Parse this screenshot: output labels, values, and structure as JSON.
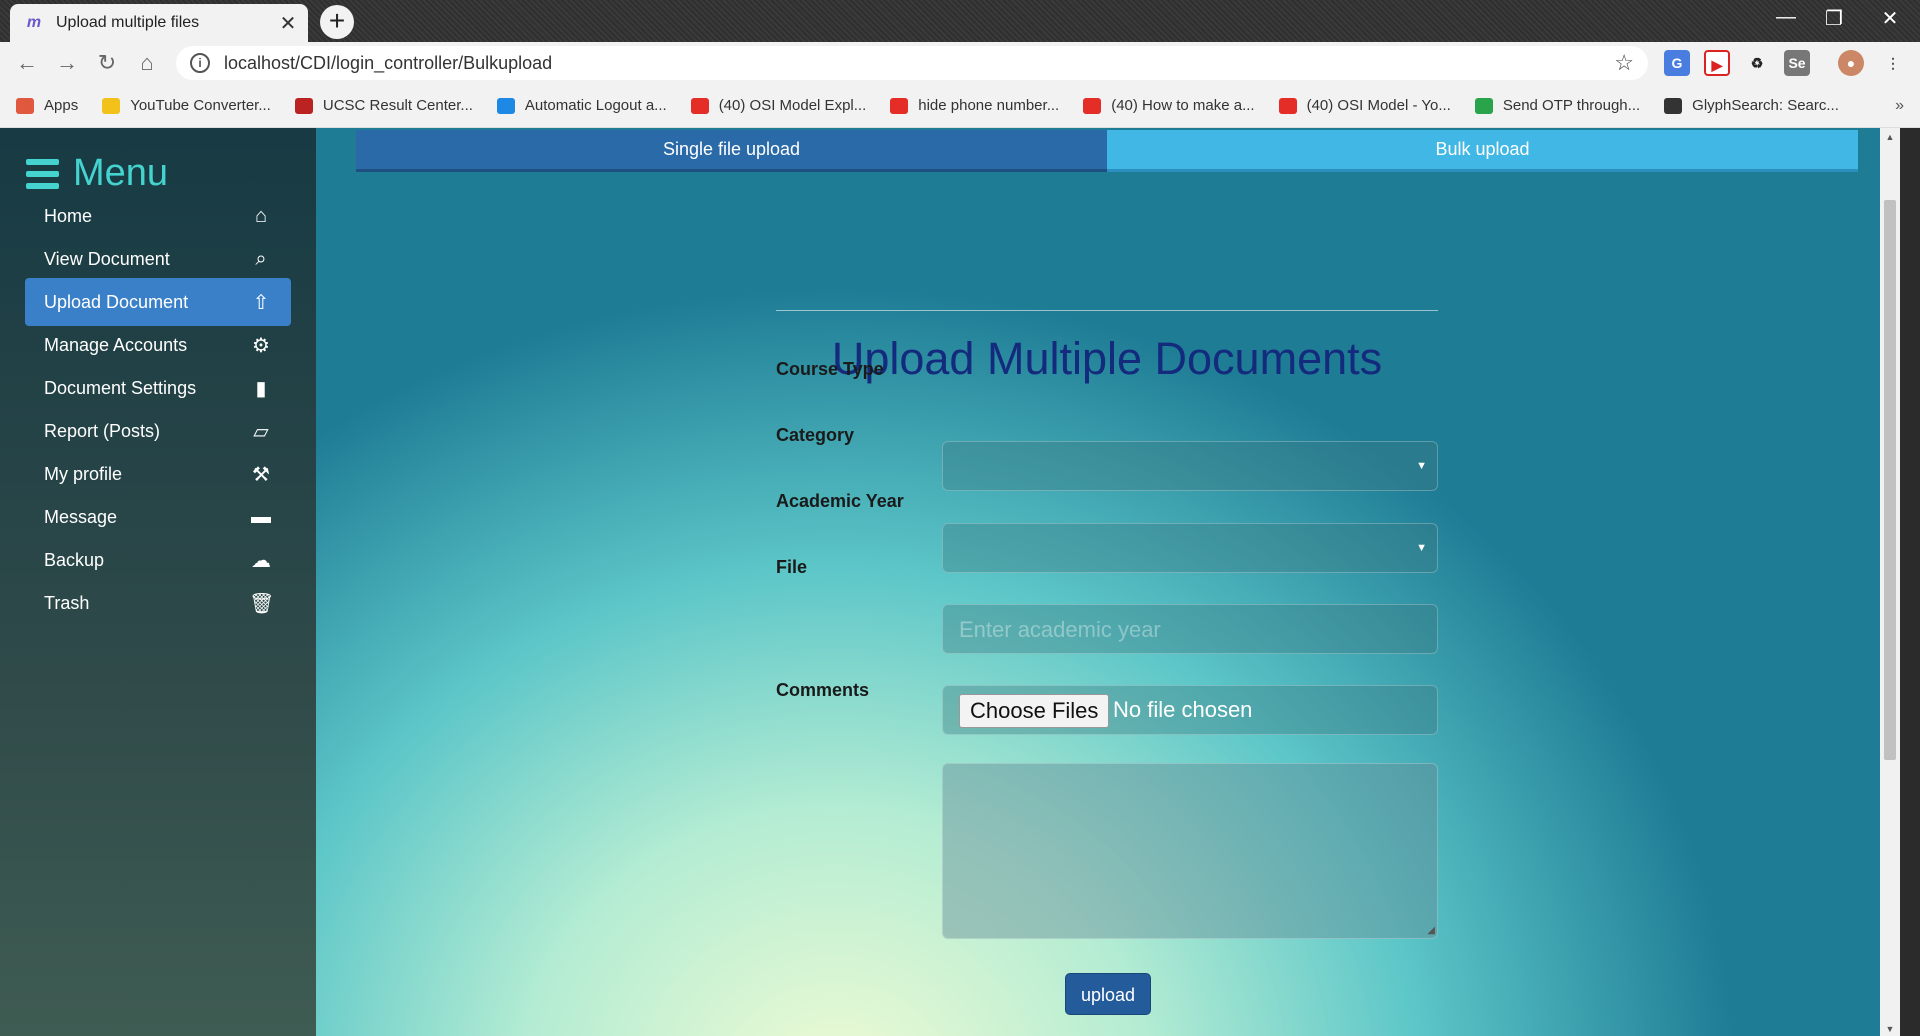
{
  "browser": {
    "tab_title": "Upload multiple files",
    "tab_close": "✕",
    "new_tab": "+",
    "window_controls": {
      "minimize": "—",
      "maximize": "❐",
      "close": "✕"
    },
    "url": "localhost/CDI/login_controller/Bulkupload",
    "bookmarks": [
      {
        "label": "Apps",
        "icon": "apps-icon",
        "color": "#e0583d"
      },
      {
        "label": "YouTube Converter...",
        "icon": "smiley-icon",
        "color": "#f2c21b"
      },
      {
        "label": "UCSC Result Center...",
        "icon": "page-icon",
        "color": "#b22"
      },
      {
        "label": "Automatic Logout a...",
        "icon": "w-icon",
        "color": "#1e88e5"
      },
      {
        "label": "(40) OSI Model Expl...",
        "icon": "youtube-icon",
        "color": "#e52d27"
      },
      {
        "label": "hide phone number...",
        "icon": "youtube-icon",
        "color": "#e52d27"
      },
      {
        "label": "(40) How to make a...",
        "icon": "youtube-icon",
        "color": "#e52d27"
      },
      {
        "label": "(40) OSI Model - Yo...",
        "icon": "youtube-icon",
        "color": "#e52d27"
      },
      {
        "label": "Send OTP through...",
        "icon": "s-icon",
        "color": "#2aa44a"
      },
      {
        "label": "GlyphSearch: Searc...",
        "icon": "glyph-icon",
        "color": "#333"
      }
    ],
    "more_bookmarks": "»"
  },
  "sidebar": {
    "title": "Menu",
    "items": [
      {
        "label": "Home",
        "icon": "⌂",
        "active": false
      },
      {
        "label": "View Document",
        "icon": "⌕",
        "active": false
      },
      {
        "label": "Upload Document",
        "icon": "⇧",
        "active": true
      },
      {
        "label": "Manage Accounts",
        "icon": "⚙",
        "active": false
      },
      {
        "label": "Document Settings",
        "icon": "▮",
        "active": false
      },
      {
        "label": "Report (Posts)",
        "icon": "▱",
        "active": false
      },
      {
        "label": "My profile",
        "icon": "⚒",
        "active": false
      },
      {
        "label": "Message",
        "icon": "▬",
        "active": false
      },
      {
        "label": "Backup",
        "icon": "☁",
        "active": false
      },
      {
        "label": "Trash",
        "icon": "🗑",
        "active": false
      }
    ]
  },
  "tabs": {
    "single": "Single file upload",
    "bulk": "Bulk upload"
  },
  "form": {
    "title": "Upload Multiple Documents",
    "course_type_label": "Course Type",
    "category_label": "Category",
    "academic_year_label": "Academic Year",
    "academic_year_placeholder": "Enter academic year",
    "file_label": "File",
    "choose_files": "Choose Files",
    "no_file": "No file chosen",
    "comments_label": "Comments",
    "submit": "upload"
  },
  "colors": {
    "accent": "#45d3cf",
    "active_nav": "#3a80c8",
    "title": "#142a7c",
    "upload_button": "#245b9b"
  }
}
